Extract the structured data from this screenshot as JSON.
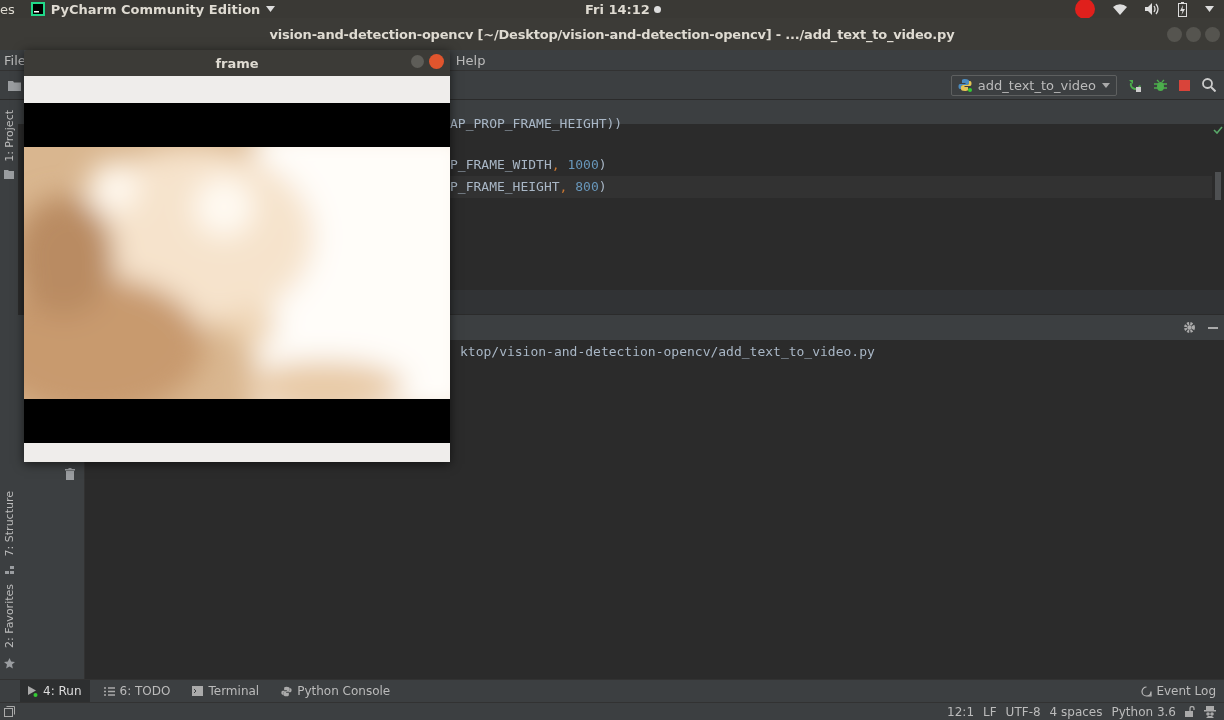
{
  "top_panel": {
    "activities": "es",
    "app_menu": "PyCharm Community Edition",
    "clock": "Fri 14:12"
  },
  "window": {
    "title": "vision-and-detection-opencv [~/Desktop/vision-and-detection-opencv] - .../add_text_to_video.py"
  },
  "menu": [
    "File",
    "Help"
  ],
  "run_config": {
    "label": "add_text_to_video"
  },
  "side_tabs_top": [
    {
      "label": "1: Project",
      "selected": false
    }
  ],
  "side_tabs_bottom": [
    {
      "label": "7: Structure",
      "selected": false
    },
    {
      "label": "2: Favorites",
      "selected": false
    }
  ],
  "code_lines": [
    {
      "parts": [
        {
          "text": "AP_PROP_FRAME_HEIGHT))",
          "kind": "plain"
        }
      ]
    },
    {
      "parts": [
        {
          "text": "P_FRAME_WIDTH",
          "kind": "plain"
        },
        {
          "text": ", ",
          "kind": "punct"
        },
        {
          "text": "1000",
          "kind": "number"
        },
        {
          "text": ")",
          "kind": "plain"
        }
      ]
    },
    {
      "parts": [
        {
          "text": "P_FRAME_HEIGHT",
          "kind": "plain"
        },
        {
          "text": ", ",
          "kind": "punct"
        },
        {
          "text": "800",
          "kind": "number"
        },
        {
          "text": ")",
          "kind": "plain"
        }
      ]
    }
  ],
  "run_output": [
    "ktop/vision-and-detection-opencv/add_text_to_video.py"
  ],
  "frame_window": {
    "title": "frame"
  },
  "bottom_tabs": [
    {
      "label": "4: Run",
      "selected": true
    },
    {
      "label": "6: TODO",
      "selected": false
    },
    {
      "label": "Terminal",
      "selected": false
    },
    {
      "label": "Python Console",
      "selected": false
    }
  ],
  "event_log": "Event Log",
  "status_bar": [
    "12:1",
    "LF",
    "UTF-8",
    "4 spaces",
    "Python 3.6"
  ]
}
